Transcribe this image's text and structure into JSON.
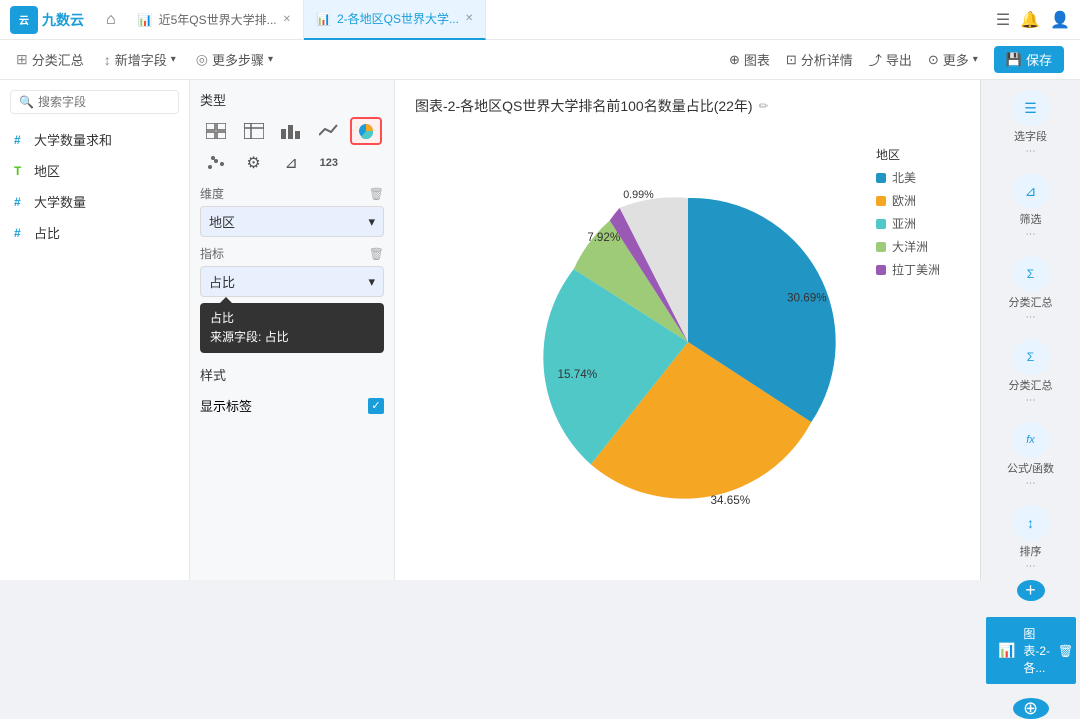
{
  "app": {
    "logo_text": "九数云",
    "home_icon": "⌂"
  },
  "tabs": [
    {
      "id": "tab1",
      "label": "近5年QS世界大学排...",
      "active": false,
      "closable": true
    },
    {
      "id": "tab2",
      "label": "2-各地区QS世界大学...",
      "active": true,
      "closable": true
    }
  ],
  "toolbar": {
    "items": [
      {
        "icon": "⊞",
        "label": "分类汇总"
      },
      {
        "icon": "⊟",
        "label": "新增字段",
        "has_arrow": true
      },
      {
        "icon": "◎",
        "label": "更多步骤",
        "has_arrow": true
      }
    ],
    "right_items": [
      {
        "icon": "☷",
        "label": "图表"
      },
      {
        "icon": "⊡",
        "label": "分析详情"
      },
      {
        "icon": "⤴",
        "label": "导出"
      },
      {
        "icon": "⋯",
        "label": "更多",
        "has_arrow": true
      },
      {
        "icon": "💾",
        "label": "保存",
        "is_save": true
      }
    ]
  },
  "search": {
    "placeholder": "搜索字段"
  },
  "fields": [
    {
      "tag": "#",
      "label": "大学数量求和",
      "type": "hash"
    },
    {
      "tag": "T",
      "label": "地区",
      "type": "T"
    },
    {
      "tag": "#",
      "label": "大学数量",
      "type": "hash"
    },
    {
      "tag": "#",
      "label": "占比",
      "type": "hash"
    }
  ],
  "chart_panel": {
    "type_label": "类型",
    "chart_types": [
      {
        "id": "table",
        "icon": "⊟",
        "label": "表格"
      },
      {
        "id": "cross",
        "icon": "⊞",
        "label": "交叉表"
      },
      {
        "id": "bar",
        "icon": "▦",
        "label": "柱状图"
      },
      {
        "id": "line",
        "icon": "〜",
        "label": "折线图"
      },
      {
        "id": "pie",
        "icon": "◕",
        "label": "饼图",
        "active": true
      },
      {
        "id": "scatter",
        "icon": "⁙",
        "label": "散点图"
      },
      {
        "id": "gear",
        "icon": "⚙",
        "label": "设置"
      },
      {
        "id": "filter2",
        "icon": "⊿",
        "label": "筛选"
      },
      {
        "id": "num",
        "icon": "123",
        "label": "数字"
      }
    ],
    "dimension_label": "维度",
    "dimension_value": "地区",
    "metric_label": "指标",
    "metric_value": "占比",
    "tooltip_title": "占比",
    "tooltip_source": "来源字段: 占比",
    "style_label": "样式",
    "show_label_label": "显示标签",
    "show_label_checked": true
  },
  "chart": {
    "title": "图表-2-各地区QS世界大学排名前100名数量占比(22年)",
    "legend": {
      "title": "地区",
      "items": [
        {
          "label": "北美",
          "color": "#2196c4"
        },
        {
          "label": "欧洲",
          "color": "#f5a623"
        },
        {
          "label": "亚洲",
          "color": "#50c8c8"
        },
        {
          "label": "大洋洲",
          "color": "#9ecb78"
        },
        {
          "label": "拉丁美洲",
          "color": "#9b59b6"
        }
      ]
    },
    "segments": [
      {
        "label": "北美",
        "value": "30.69%",
        "color": "#2196c4",
        "percent": 30.69
      },
      {
        "label": "欧洲",
        "value": "34.65%",
        "color": "#f5a623",
        "percent": 34.65
      },
      {
        "label": "亚洲",
        "value": "15.74%",
        "color": "#50c8c8",
        "percent": 15.74
      },
      {
        "label": "大洋洲",
        "value": "7.92%",
        "color": "#9ecb78",
        "percent": 7.92
      },
      {
        "label": "拉丁美洲",
        "value": "0.99%",
        "color": "#9b59b6",
        "percent": 0.99
      }
    ]
  },
  "right_sidebar": {
    "steps": [
      {
        "id": "select",
        "icon": "☰",
        "label": "选字段"
      },
      {
        "id": "filter",
        "icon": "⊿",
        "label": "筛选"
      },
      {
        "id": "summary1",
        "icon": "Σ",
        "label": "分类汇总"
      },
      {
        "id": "summary2",
        "icon": "Σ",
        "label": "分类汇总"
      },
      {
        "id": "formula",
        "icon": "fx",
        "label": "公式/函数"
      },
      {
        "id": "sort",
        "icon": "↕",
        "label": "排序"
      }
    ],
    "bottom_step": "图表-2-各..."
  }
}
